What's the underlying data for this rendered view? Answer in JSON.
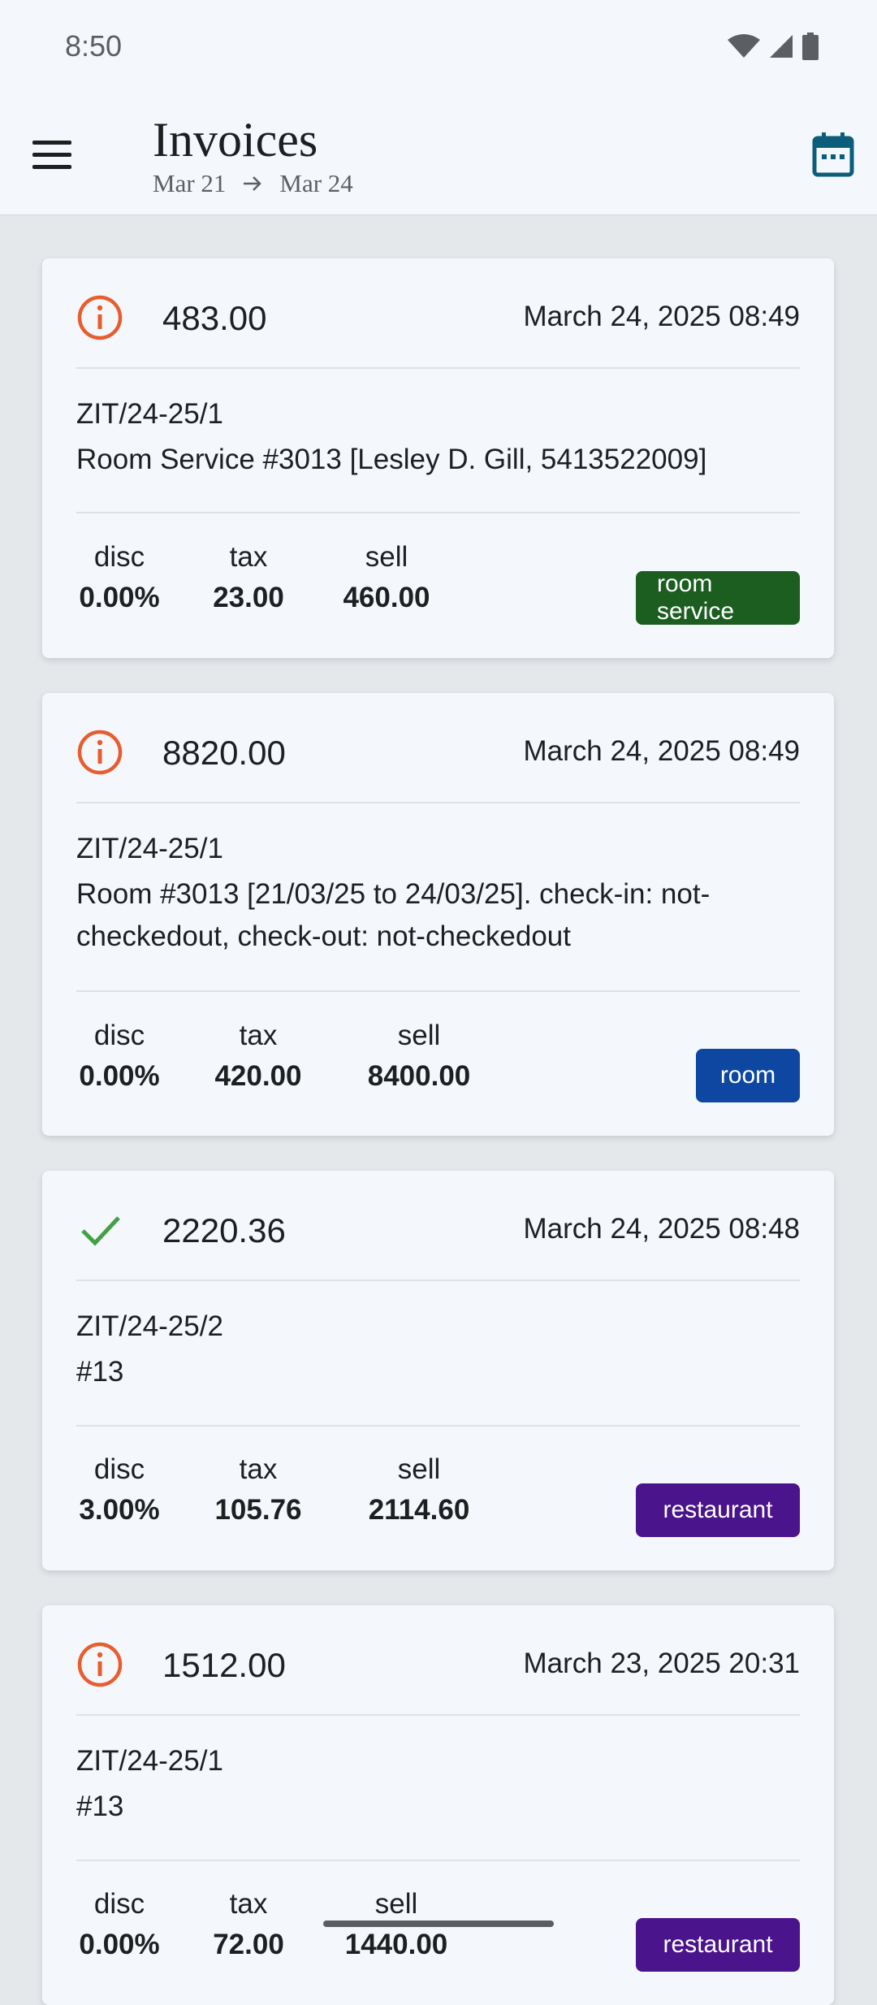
{
  "status_bar": {
    "time": "8:50"
  },
  "header": {
    "title": "Invoices",
    "date_from": "Mar 21",
    "date_to": "Mar 24"
  },
  "labels": {
    "disc": "disc",
    "tax": "tax",
    "sell": "sell"
  },
  "colors": {
    "accent": "#0b5d7a",
    "warning": "#e85d2e",
    "success": "#43a047",
    "tag_room_service": "#1b5e20",
    "tag_room": "#0d47a1",
    "tag_restaurant": "#4a148c"
  },
  "invoices": [
    {
      "status": "warning",
      "status_icon": "info-icon",
      "amount": "483.00",
      "date": "March 24, 2025 08:49",
      "ref": "ZIT/24-25/1",
      "description": "Room Service #3013 [Lesley D. Gill, 5413522009]",
      "disc": "0.00%",
      "tax": "23.00",
      "sell": "460.00",
      "tag": "room service"
    },
    {
      "status": "warning",
      "status_icon": "info-icon",
      "amount": "8820.00",
      "date": "March 24, 2025 08:49",
      "ref": "ZIT/24-25/1",
      "description": "Room #3013 [21/03/25 to 24/03/25]. check-in: not-checkedout, check-out: not-checkedout",
      "disc": "0.00%",
      "tax": "420.00",
      "sell": "8400.00",
      "tag": "room"
    },
    {
      "status": "paid",
      "status_icon": "check-icon",
      "amount": "2220.36",
      "date": "March 24, 2025 08:48",
      "ref": "ZIT/24-25/2",
      "description": "#13",
      "disc": "3.00%",
      "tax": "105.76",
      "sell": "2114.60",
      "tag": "restaurant"
    },
    {
      "status": "warning",
      "status_icon": "info-icon",
      "amount": "1512.00",
      "date": "March 23, 2025 20:31",
      "ref": "ZIT/24-25/1",
      "description": "#13",
      "disc": "0.00%",
      "tax": "72.00",
      "sell": "1440.00",
      "tag": "restaurant"
    }
  ]
}
